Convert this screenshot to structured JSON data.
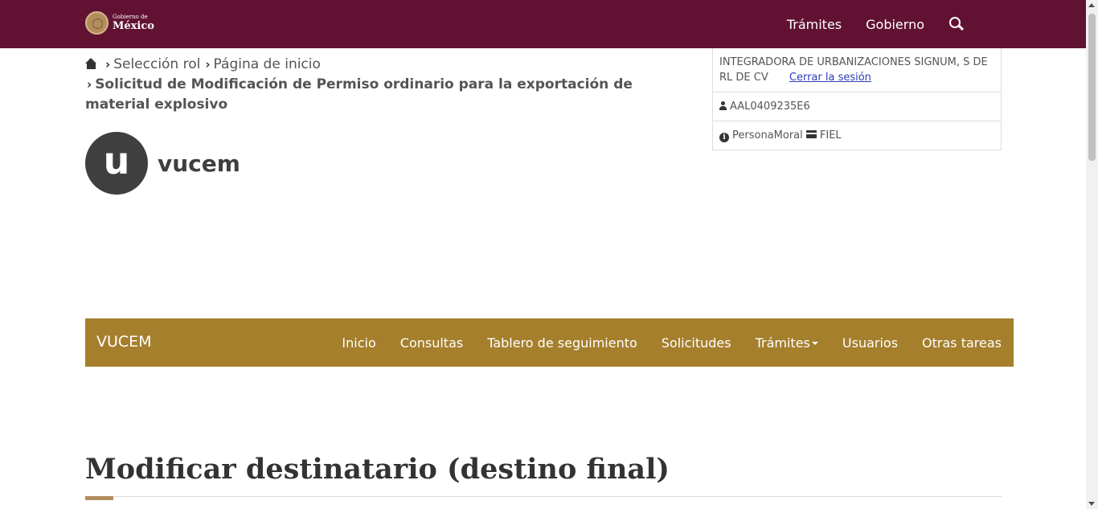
{
  "gob_header": {
    "logo_small": "Gobierno de",
    "logo_big": "México",
    "nav": [
      "Trámites",
      "Gobierno"
    ],
    "search_icon": "search-icon",
    "color": "#611232"
  },
  "breadcrumb": {
    "home_icon": "home-icon",
    "items": [
      "Selección rol",
      "Página de inicio"
    ],
    "current": "Solicitud de Modificación de Permiso ordinario para la exportación de material explosivo"
  },
  "user": {
    "company": "INTEGRADORA DE URBANIZACIONES SIGNUM, S DE RL DE CV",
    "logout": "Cerrar la sesión",
    "rfc": "AAL0409235E6",
    "person_type": "PersonaMoral",
    "signature": "FIEL"
  },
  "logo": {
    "mark": "u",
    "word": "vucem"
  },
  "navbar": {
    "brand": "VUCEM",
    "items": [
      "Inicio",
      "Consultas",
      "Tablero de seguimiento",
      "Solicitudes",
      "Trámites",
      "Usuarios",
      "Otras tareas"
    ],
    "color": "#a57f2c"
  },
  "page": {
    "title": "Modificar destinatario (destino final)",
    "accent_color": "#b38e5d"
  }
}
